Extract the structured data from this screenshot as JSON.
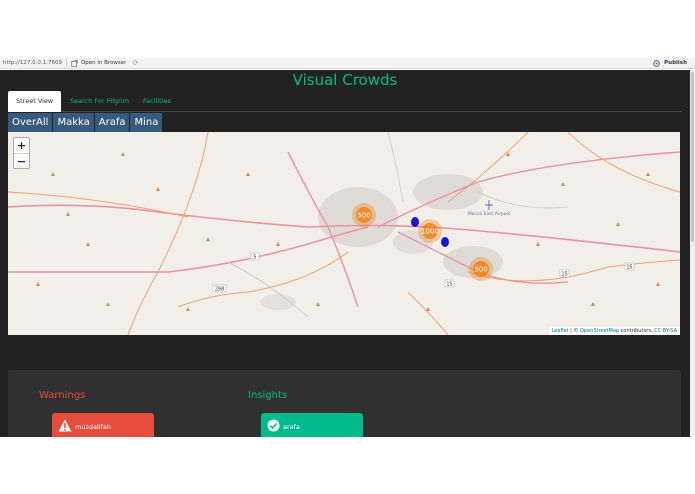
{
  "browser": {
    "url": "http://127.0.0.1:7609",
    "open_in_browser": "Open in Browser",
    "publish": "Publish"
  },
  "app": {
    "title": "Visual Crowds",
    "tabs": [
      {
        "label": "Street View",
        "active": true
      },
      {
        "label": "Search For Pilgrim",
        "active": false
      },
      {
        "label": "Facilities",
        "active": false
      }
    ],
    "location_buttons": [
      "OverAll",
      "Makka",
      "Arafa",
      "Mina"
    ]
  },
  "map": {
    "zoom_in": "+",
    "zoom_out": "−",
    "clusters": [
      {
        "label": "500"
      },
      {
        "label": "1000"
      },
      {
        "label": "500"
      }
    ],
    "place_label": "Mecca East Airport",
    "road_labels": [
      "5",
      "298",
      "15",
      "15",
      "15"
    ],
    "attribution": {
      "leaflet": "Leaflet",
      "sep": " | © ",
      "osm": "OpenStreetMap",
      "contrib": " contributors, ",
      "license": "CC-BY-SA"
    }
  },
  "panels": {
    "warnings_title": "Warnings",
    "insights_title": "Insights",
    "warning_item": "muzdalifah",
    "insight_item": "arafa"
  },
  "colors": {
    "accent": "#00bc8c",
    "danger": "#e74c3c",
    "button": "#375a7f",
    "background": "#222222"
  }
}
